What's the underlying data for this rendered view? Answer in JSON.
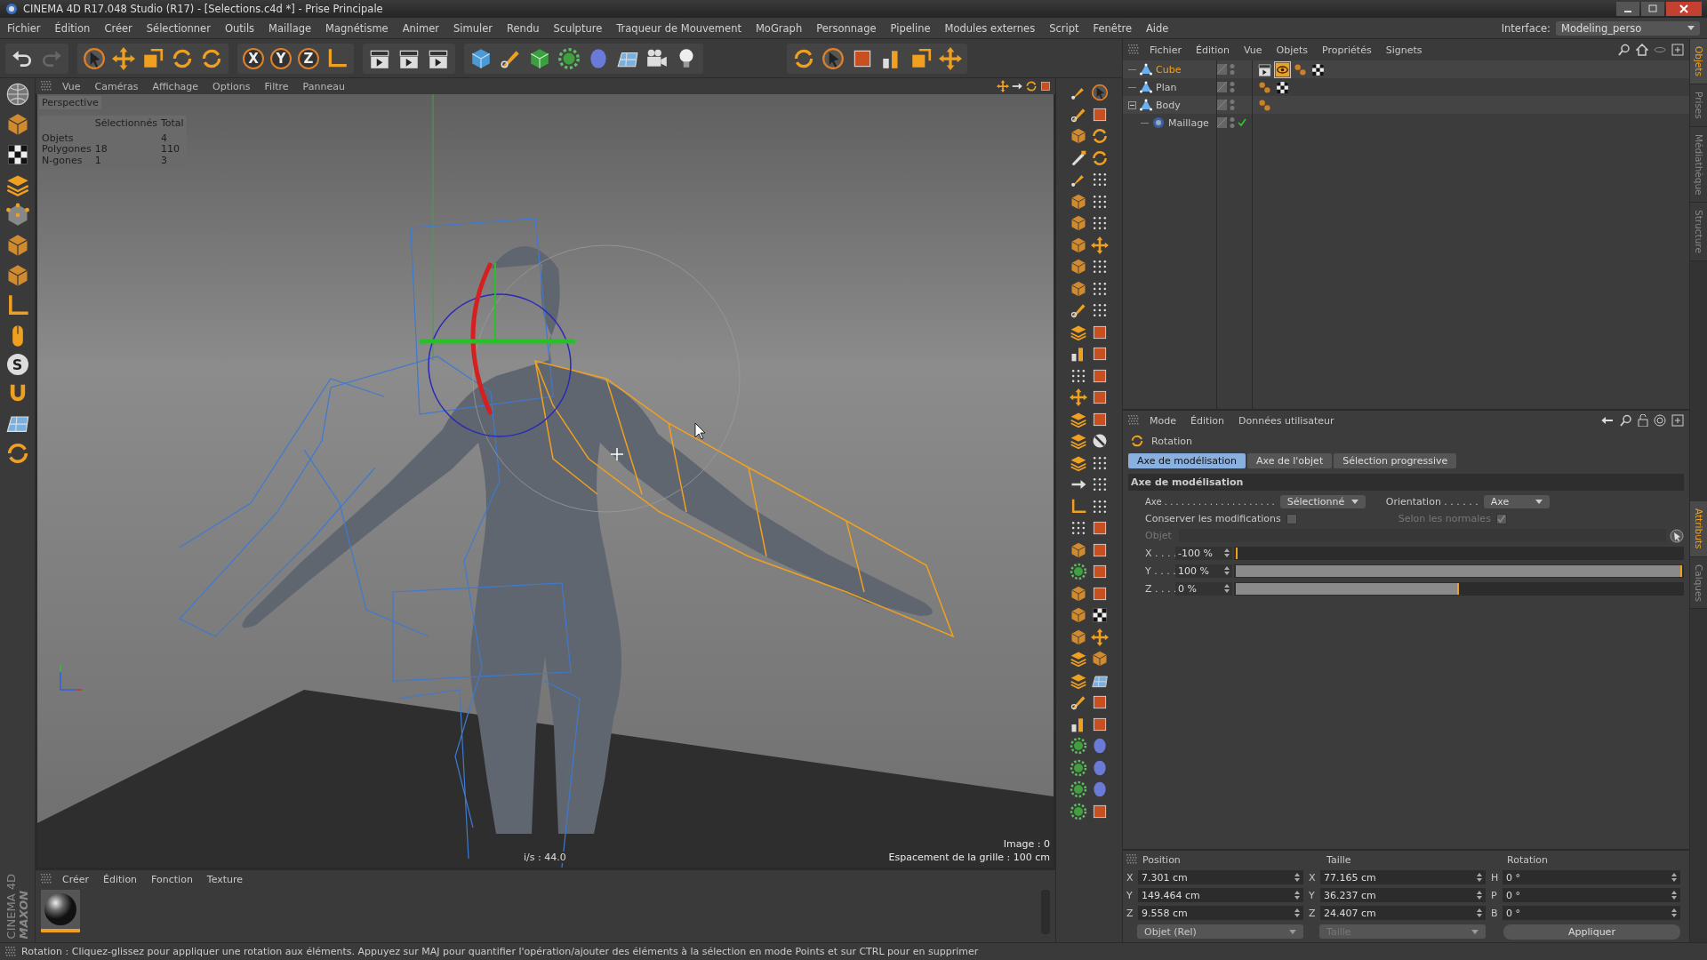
{
  "window": {
    "title": "CINEMA 4D R17.048 Studio (R17) - [Selections.c4d *] - Prise Principale"
  },
  "menu_bar": [
    "Fichier",
    "Édition",
    "Créer",
    "Sélectionner",
    "Outils",
    "Maillage",
    "Magnétisme",
    "Animer",
    "Simuler",
    "Rendu",
    "Sculpture",
    "Traqueur de Mouvement",
    "MoGraph",
    "Personnage",
    "Pipeline",
    "Modules externes",
    "Script",
    "Fenêtre",
    "Aide"
  ],
  "interface": {
    "label": "Interface:",
    "value": "Modeling_perso"
  },
  "toolbar": {
    "axis_locks": [
      "X",
      "Y",
      "Z"
    ]
  },
  "left_toolbar": {
    "snap_label": "S"
  },
  "logo": {
    "brand": "MAXON",
    "product": "CINEMA 4D"
  },
  "viewport": {
    "menu": [
      "Vue",
      "Caméras",
      "Affichage",
      "Options",
      "Filtre",
      "Panneau"
    ],
    "camera": "Perspective",
    "stats": {
      "columns": [
        "Sélectionnés",
        "Total"
      ],
      "rows": [
        {
          "label": "Objets",
          "total": "4"
        },
        {
          "label": "Polygones",
          "selected": "18",
          "total": "110"
        },
        {
          "label": "N-gones",
          "selected": "1",
          "total": "3"
        }
      ]
    },
    "frame": "Image : 0",
    "fps": "i/s : 44.0",
    "grid": "Espacement de la grille : 100 cm"
  },
  "material_manager": {
    "menu": [
      "Créer",
      "Édition",
      "Fonction",
      "Texture"
    ],
    "materials": [
      {
        "selected": true
      }
    ]
  },
  "status_bar": "Rotation : Cliquez-glissez pour appliquer une rotation aux éléments. Appuyez sur MAJ pour quantifier l'opération/ajouter des éléments à la sélection en mode Points et sur CTRL pour en supprimer",
  "object_manager": {
    "menu": [
      "Fichier",
      "Édition",
      "Vue",
      "Objets",
      "Propriétés",
      "Signets"
    ],
    "objects": [
      {
        "name": "Cube",
        "kind": "polygon",
        "selected": true,
        "tags": [
          {
            "kind": "clapper",
            "selected": false
          },
          {
            "kind": "eye",
            "selected": true
          },
          {
            "kind": "spheres",
            "selected": false
          },
          {
            "kind": "checker",
            "selected": false
          }
        ]
      },
      {
        "name": "Plan",
        "kind": "polygon",
        "selected": false,
        "tags": [
          {
            "kind": "spheres",
            "selected": false
          },
          {
            "kind": "checker",
            "selected": false
          }
        ]
      },
      {
        "name": "Body",
        "kind": "polygon",
        "selected": false,
        "expanded": true,
        "tags": [
          {
            "kind": "spheres",
            "selected": false
          }
        ],
        "children": [
          {
            "name": "Maillage",
            "kind": "mesh",
            "selected": false
          }
        ]
      }
    ]
  },
  "side_tabs_top": [
    {
      "label": "Objets",
      "selected": true
    },
    {
      "label": "Prises",
      "selected": false
    },
    {
      "label": "Médiathèque",
      "selected": false
    },
    {
      "label": "Structure",
      "selected": false
    }
  ],
  "side_tabs_bottom": [
    {
      "label": "Attributs",
      "selected": true
    },
    {
      "label": "Calques",
      "selected": false
    }
  ],
  "attributes": {
    "menu": [
      "Mode",
      "Édition",
      "Données utilisateur"
    ],
    "tool": "Rotation",
    "tabs": [
      {
        "label": "Axe de modélisation",
        "selected": true
      },
      {
        "label": "Axe de l'objet",
        "selected": false
      },
      {
        "label": "Sélection progressive",
        "selected": false
      }
    ],
    "section": "Axe de modélisation",
    "axe": {
      "label": "Axe . . . . . . . . . . . . . . . . . . . .",
      "value": "Sélectionné"
    },
    "orientation": {
      "label": "Orientation . . . . . .",
      "value": "Axe"
    },
    "keep": {
      "label": "Conserver les modifications",
      "checked": false
    },
    "normals": {
      "label": "Selon les normales",
      "checked": true,
      "disabled": true
    },
    "object": {
      "label": "Objet",
      "disabled": true
    },
    "sliders": [
      {
        "label": "X . . . .",
        "value": "-100 %",
        "level": 0
      },
      {
        "label": "Y . . . .",
        "value": "100 %",
        "level": 1
      },
      {
        "label": "Z . . . .",
        "value": "0 %",
        "level": 0.5
      }
    ]
  },
  "coordinates": {
    "headers": [
      "Position",
      "Taille",
      "Rotation"
    ],
    "rows": [
      {
        "pos_axis": "X",
        "pos": "7.301 cm",
        "size_axis": "X",
        "size": "77.165 cm",
        "rot_axis": "H",
        "rot": "0 °"
      },
      {
        "pos_axis": "Y",
        "pos": "149.464 cm",
        "size_axis": "Y",
        "size": "36.237 cm",
        "rot_axis": "P",
        "rot": "0 °"
      },
      {
        "pos_axis": "Z",
        "pos": "9.558 cm",
        "size_axis": "Z",
        "size": "24.407 cm",
        "rot_axis": "B",
        "rot": "0 °"
      }
    ],
    "mode": "Objet (Rel)",
    "size_mode": "Taille",
    "apply": "Appliquer"
  }
}
